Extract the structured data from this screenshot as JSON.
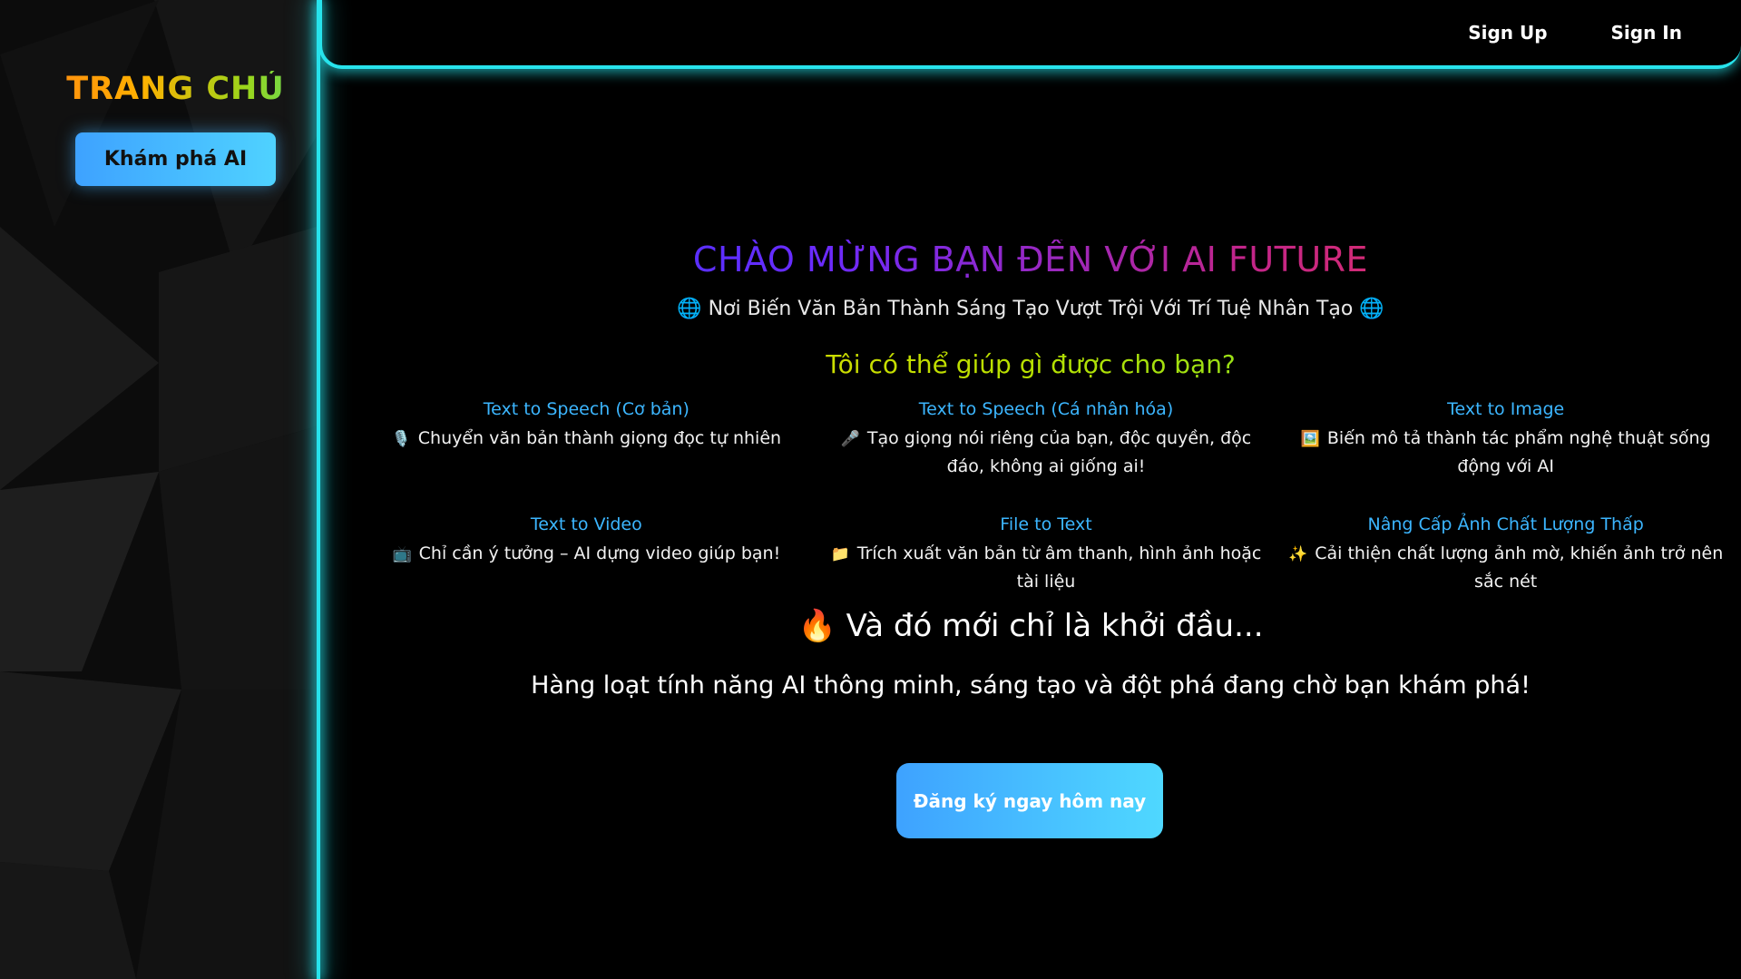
{
  "sidebar": {
    "brand": "TRANG CHỦ",
    "explore_button": "Khám phá AI"
  },
  "topnav": {
    "sign_up": "Sign Up",
    "sign_in": "Sign In"
  },
  "hero": {
    "title": "CHÀO MỪNG BẠN ĐẾN VỚI AI FUTURE",
    "subtitle_icon": "🌐",
    "subtitle": "Nơi Biến Văn Bản Thành Sáng Tạo Vượt Trội Với Trí Tuệ Nhân Tạo",
    "question": "Tôi có thể giúp gì được cho bạn?"
  },
  "features": [
    {
      "title": "Text to Speech (Cơ bản)",
      "icon": "🎙️",
      "icon_name": "microphone-icon",
      "desc": "Chuyển văn bản thành giọng đọc tự nhiên"
    },
    {
      "title": "Text to Speech (Cá nhân hóa)",
      "icon": "🎤",
      "icon_name": "mic-icon",
      "desc": "Tạo giọng nói riêng của bạn, độc quyền, độc đáo, không ai giống ai!"
    },
    {
      "title": "Text to Image",
      "icon": "🖼️",
      "icon_name": "picture-icon",
      "desc": "Biến mô tả thành tác phẩm nghệ thuật sống động với AI"
    },
    {
      "title": "Text to Video",
      "icon": "📺",
      "icon_name": "tv-icon",
      "desc": "Chỉ cần ý tưởng – AI dựng video giúp bạn!"
    },
    {
      "title": "File to Text",
      "icon": "📁",
      "icon_name": "folder-icon",
      "desc": "Trích xuất văn bản từ âm thanh, hình ảnh hoặc tài liệu"
    },
    {
      "title": "Nâng Cấp Ảnh Chất Lượng Thấp",
      "icon": "✨",
      "icon_name": "sparkles-icon",
      "desc": "Cải thiện chất lượng ảnh mờ, khiến ảnh trở nên sắc nét"
    }
  ],
  "closing": {
    "icon": "🔥",
    "headline": "Và đó mới chỉ là khởi đầu...",
    "tagline": "Hàng loạt tính năng AI thông minh, sáng tạo và đột phá đang chờ bạn khám phá!",
    "cta": "Đăng ký ngay hôm nay"
  },
  "colors": {
    "neon": "#27e3ec",
    "button_start": "#3ea2ff",
    "button_end": "#4fd2ff",
    "feature_title": "#3cb6ff"
  }
}
